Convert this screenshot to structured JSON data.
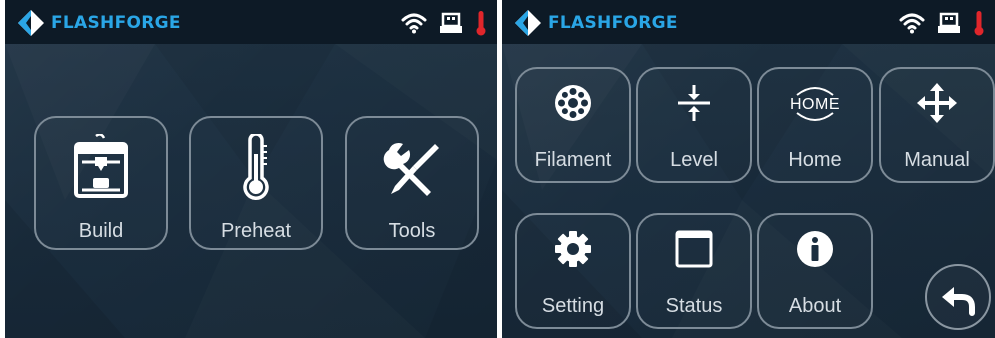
{
  "left_screen": {
    "brand": "FLASHFORGE",
    "status_icons": [
      "wifi-icon",
      "usb-icon",
      "thermometer-icon"
    ],
    "menu": [
      {
        "label": "Build",
        "icon": "printer-icon"
      },
      {
        "label": "Preheat",
        "icon": "thermometer-icon"
      },
      {
        "label": "Tools",
        "icon": "tools-icon"
      }
    ]
  },
  "right_screen": {
    "brand": "FLASHFORGE",
    "status_icons": [
      "wifi-icon",
      "usb-icon",
      "thermometer-icon"
    ],
    "menu": [
      {
        "label": "Filament",
        "icon": "filament-spool-icon"
      },
      {
        "label": "Level",
        "icon": "level-arrows-icon"
      },
      {
        "label": "Home",
        "icon": "home-axis-icon",
        "icon_text": "HOME"
      },
      {
        "label": "Manual",
        "icon": "move-arrows-icon"
      },
      {
        "label": "Setting",
        "icon": "gear-icon"
      },
      {
        "label": "Status",
        "icon": "status-square-icon"
      },
      {
        "label": "About",
        "icon": "info-icon"
      }
    ],
    "back": {
      "icon": "back-arrow-icon"
    }
  },
  "colors": {
    "background": "#1b2e3f",
    "topbar": "#0d1a26",
    "brand_blue": "#2aa6e6",
    "tile_border": "#7d8b97",
    "label": "#d6dde3",
    "temp_red": "#e0262b"
  }
}
